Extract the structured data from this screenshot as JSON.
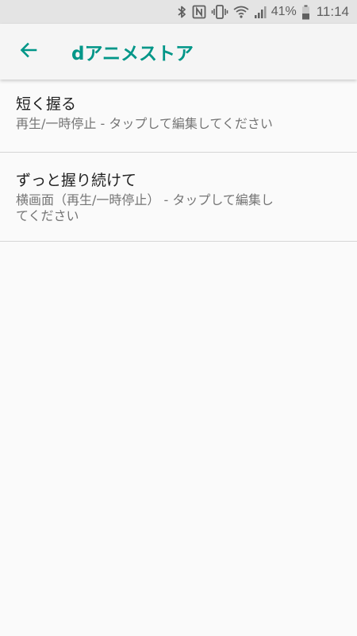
{
  "status_bar": {
    "icons": [
      "bluetooth-icon",
      "nfc-icon",
      "vibrate-icon",
      "wifi-icon",
      "cell-signal-icon",
      "battery-icon"
    ],
    "battery_percent": "41%",
    "time": "11:14"
  },
  "app_bar": {
    "back_icon": "arrow-left-icon",
    "title": "dアニメストア",
    "accent_color": "#009688"
  },
  "settings": [
    {
      "title": "短く握る",
      "summary": "再生/一時停止 - タップして編集してください"
    },
    {
      "title": "ずっと握り続けて",
      "summary": "横画面（再生/一時停止） - タップして編集してください"
    }
  ]
}
